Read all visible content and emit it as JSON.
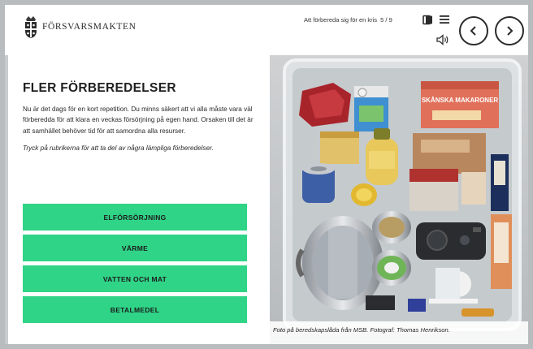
{
  "header": {
    "logo_text": "FÖRSVARSMAKTEN",
    "progress_text": "Att förbereda sig för en kris",
    "progress_page": "5 / 9"
  },
  "icons": {
    "book": "book-icon",
    "menu": "menu-icon",
    "audio": "speaker-icon",
    "prev": "chevron-left-icon",
    "next": "chevron-right-icon"
  },
  "main": {
    "title": "FLER FÖRBEREDELSER",
    "paragraph": "Nu är det dags för en kort repetition. Du minns säkert att vi alla måste vara väl förberedda för att klara en veckas försörjning på egen hand. Orsaken till det är att samhället behöver tid för att samordna alla resurser.",
    "instruction": "Tryck på rubrikerna för att ta del av några lämpliga förberedelser.",
    "choices": [
      {
        "label": "ELFÖRSÖRJNING"
      },
      {
        "label": "VÄRME"
      },
      {
        "label": "VATTEN OCH MAT"
      },
      {
        "label": "BETALMEDEL"
      }
    ]
  },
  "photo": {
    "caption": "Foto på beredskapslåda från MSB. Fotograf: Thomas Henrikson.",
    "box_label": "SKÅNSKA MAKARONER"
  },
  "colors": {
    "accent": "#2fd487",
    "text": "#1f1f1f"
  }
}
